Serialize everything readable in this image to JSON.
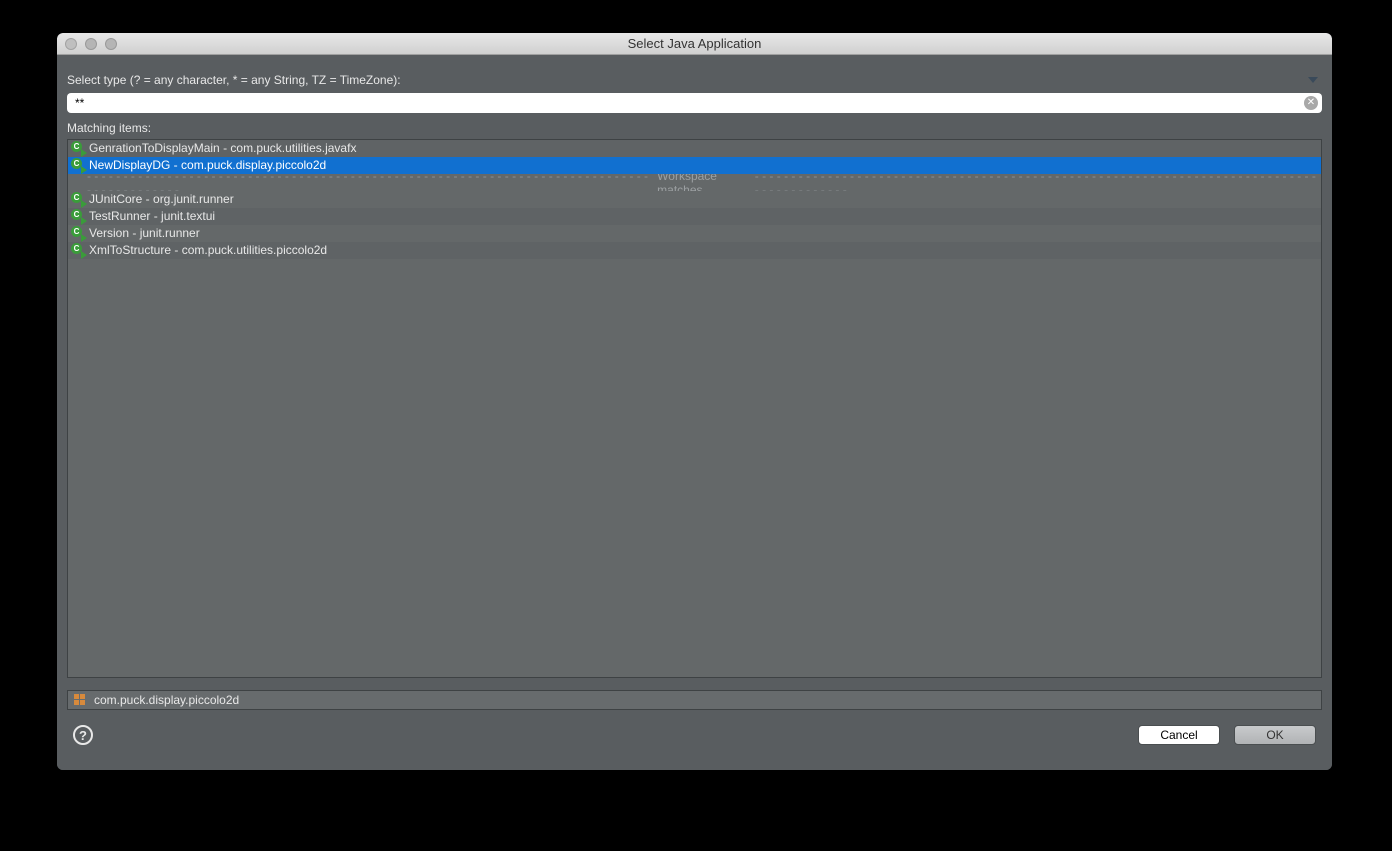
{
  "window": {
    "title": "Select Java Application"
  },
  "filter": {
    "label": "Select type (? = any character, * = any String, TZ = TimeZone):",
    "value": "**"
  },
  "matching": {
    "label": "Matching items:",
    "items": [
      {
        "text": "GenrationToDisplayMain - com.puck.utilities.javafx",
        "selected": false
      },
      {
        "text": "NewDisplayDG - com.puck.display.piccolo2d",
        "selected": true
      }
    ],
    "separator_label": "Workspace matches",
    "workspace_items": [
      {
        "text": "JUnitCore - org.junit.runner"
      },
      {
        "text": "TestRunner - junit.textui"
      },
      {
        "text": "Version - junit.runner"
      },
      {
        "text": "XmlToStructure - com.puck.utilities.piccolo2d"
      }
    ]
  },
  "status": {
    "package": "com.puck.display.piccolo2d"
  },
  "buttons": {
    "cancel": "Cancel",
    "ok": "OK"
  }
}
